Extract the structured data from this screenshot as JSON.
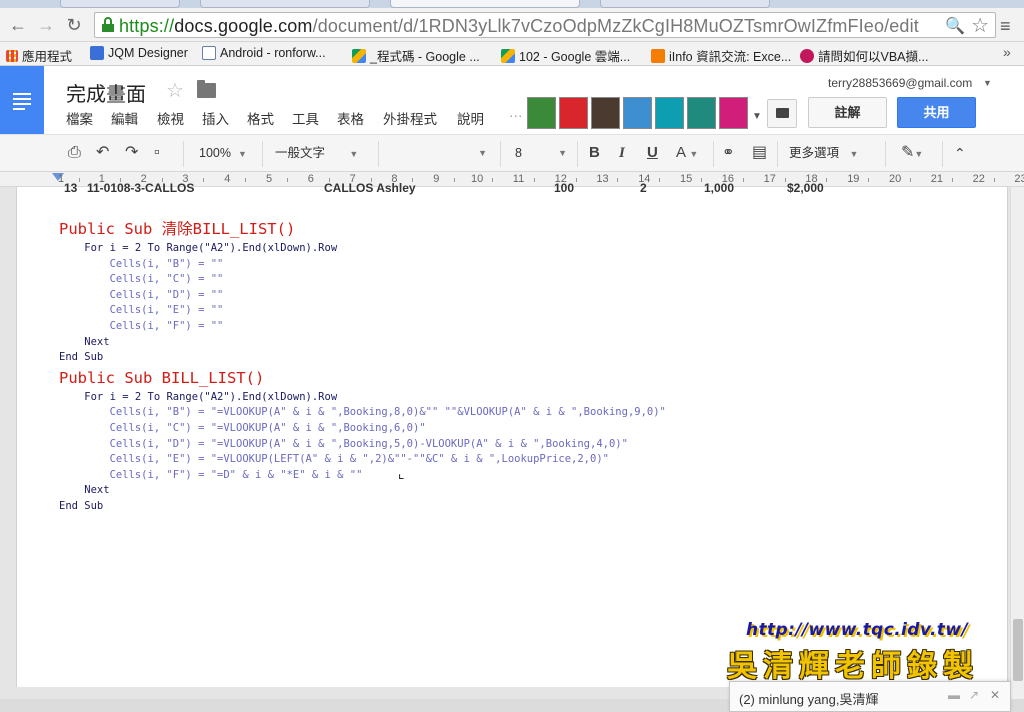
{
  "browser": {
    "url_https": "https://",
    "url_host": "docs.google.com",
    "url_path": "/document/d/1RDN3yLlk7vCzoOdpMzZkCgIH8MuOZTsmrOwIZfmFIeo/edit"
  },
  "bookmarks": [
    {
      "label": "應用程式",
      "color": "#e8453c"
    },
    {
      "label": "JQM Designer",
      "color": "#3b6fd8"
    },
    {
      "label": "Android - ronforw...",
      "color": "#ffffff"
    },
    {
      "label": "_程式碼 - Google ...",
      "color": "#f4b400"
    },
    {
      "label": "102 - Google 雲端...",
      "color": "#0f9d58"
    },
    {
      "label": "iInfo 資訊交流: Exce...",
      "color": "#f57d00"
    },
    {
      "label": "請問如何以VBA擷...",
      "color": "#c2185b"
    }
  ],
  "docs": {
    "title": "完成畫面",
    "menu": [
      "檔案",
      "編輯",
      "檢視",
      "插入",
      "格式",
      "工具",
      "表格",
      "外掛程式",
      "說明"
    ],
    "account": "terry28853669@gmail.com",
    "comment_label": "註解",
    "share_label": "共用",
    "avatar_colors": [
      "#3a8a3a",
      "#d9262c",
      "#444444",
      "#3d8fd1",
      "#0e9eb2",
      "#1e8b7e",
      "#d01e7a"
    ]
  },
  "toolbar": {
    "zoom": "100%",
    "style": "一般文字",
    "font": "",
    "size": "8",
    "more": "更多選項"
  },
  "ruler": [
    "1",
    "1",
    "2",
    "3",
    "4",
    "5",
    "6",
    "7",
    "8",
    "9",
    "10",
    "11",
    "12",
    "13",
    "14",
    "15",
    "16",
    "17",
    "18",
    "19",
    "20",
    "21",
    "22",
    "23"
  ],
  "table_row": {
    "num": "13",
    "id": "11-0108-3-CALLOS",
    "name": "CALLOS Ashley",
    "qty": "100",
    "n": "2",
    "price": "1,000",
    "total": "$2,000"
  },
  "code_lines": [
    {
      "text": "Public Sub 清除BILL_LIST()",
      "kind": "big"
    },
    {
      "text": "    For i = 2 To Range(\"A2\").End(xlDown).Row",
      "kind": "normal"
    },
    {
      "text": "        Cells(i, \"B\") = \"\"",
      "kind": "cells"
    },
    {
      "text": "        Cells(i, \"C\") = \"\"",
      "kind": "cells"
    },
    {
      "text": "        Cells(i, \"D\") = \"\"",
      "kind": "cells"
    },
    {
      "text": "        Cells(i, \"E\") = \"\"",
      "kind": "cells"
    },
    {
      "text": "        Cells(i, \"F\") = \"\"",
      "kind": "cells"
    },
    {
      "text": "    Next",
      "kind": "normal"
    },
    {
      "text": "End Sub",
      "kind": "normal"
    },
    {
      "text": "Public Sub BILL_LIST()",
      "kind": "big"
    },
    {
      "text": "    For i = 2 To Range(\"A2\").End(xlDown).Row",
      "kind": "normal"
    },
    {
      "text": "        Cells(i, \"B\") = \"=VLOOKUP(A\" & i & \",Booking,8,0)&\"\" \"\"&VLOOKUP(A\" & i & \",Booking,9,0)\"",
      "kind": "cells"
    },
    {
      "text": "        Cells(i, \"C\") = \"=VLOOKUP(A\" & i & \",Booking,6,0)\"",
      "kind": "cells"
    },
    {
      "text": "        Cells(i, \"D\") = \"=VLOOKUP(A\" & i & \",Booking,5,0)-VLOOKUP(A\" & i & \",Booking,4,0)\"",
      "kind": "cells"
    },
    {
      "text": "        Cells(i, \"E\") = \"=VLOOKUP(LEFT(A\" & i & \",2)&\"\"-\"\"&C\" & i & \",LookupPrice,2,0)\"",
      "kind": "cells"
    },
    {
      "text": "        Cells(i, \"F\") = \"=D\" & i & \"*E\" & i & \"\"",
      "kind": "cells"
    },
    {
      "text": "    Next",
      "kind": "normal"
    },
    {
      "text": "End Sub",
      "kind": "normal"
    }
  ],
  "watermark": {
    "url": "http://www.tqc.idv.tw/",
    "name": "吳清輝老師錄製"
  },
  "chat": {
    "label": "(2) minlung yang,吳清輝"
  }
}
